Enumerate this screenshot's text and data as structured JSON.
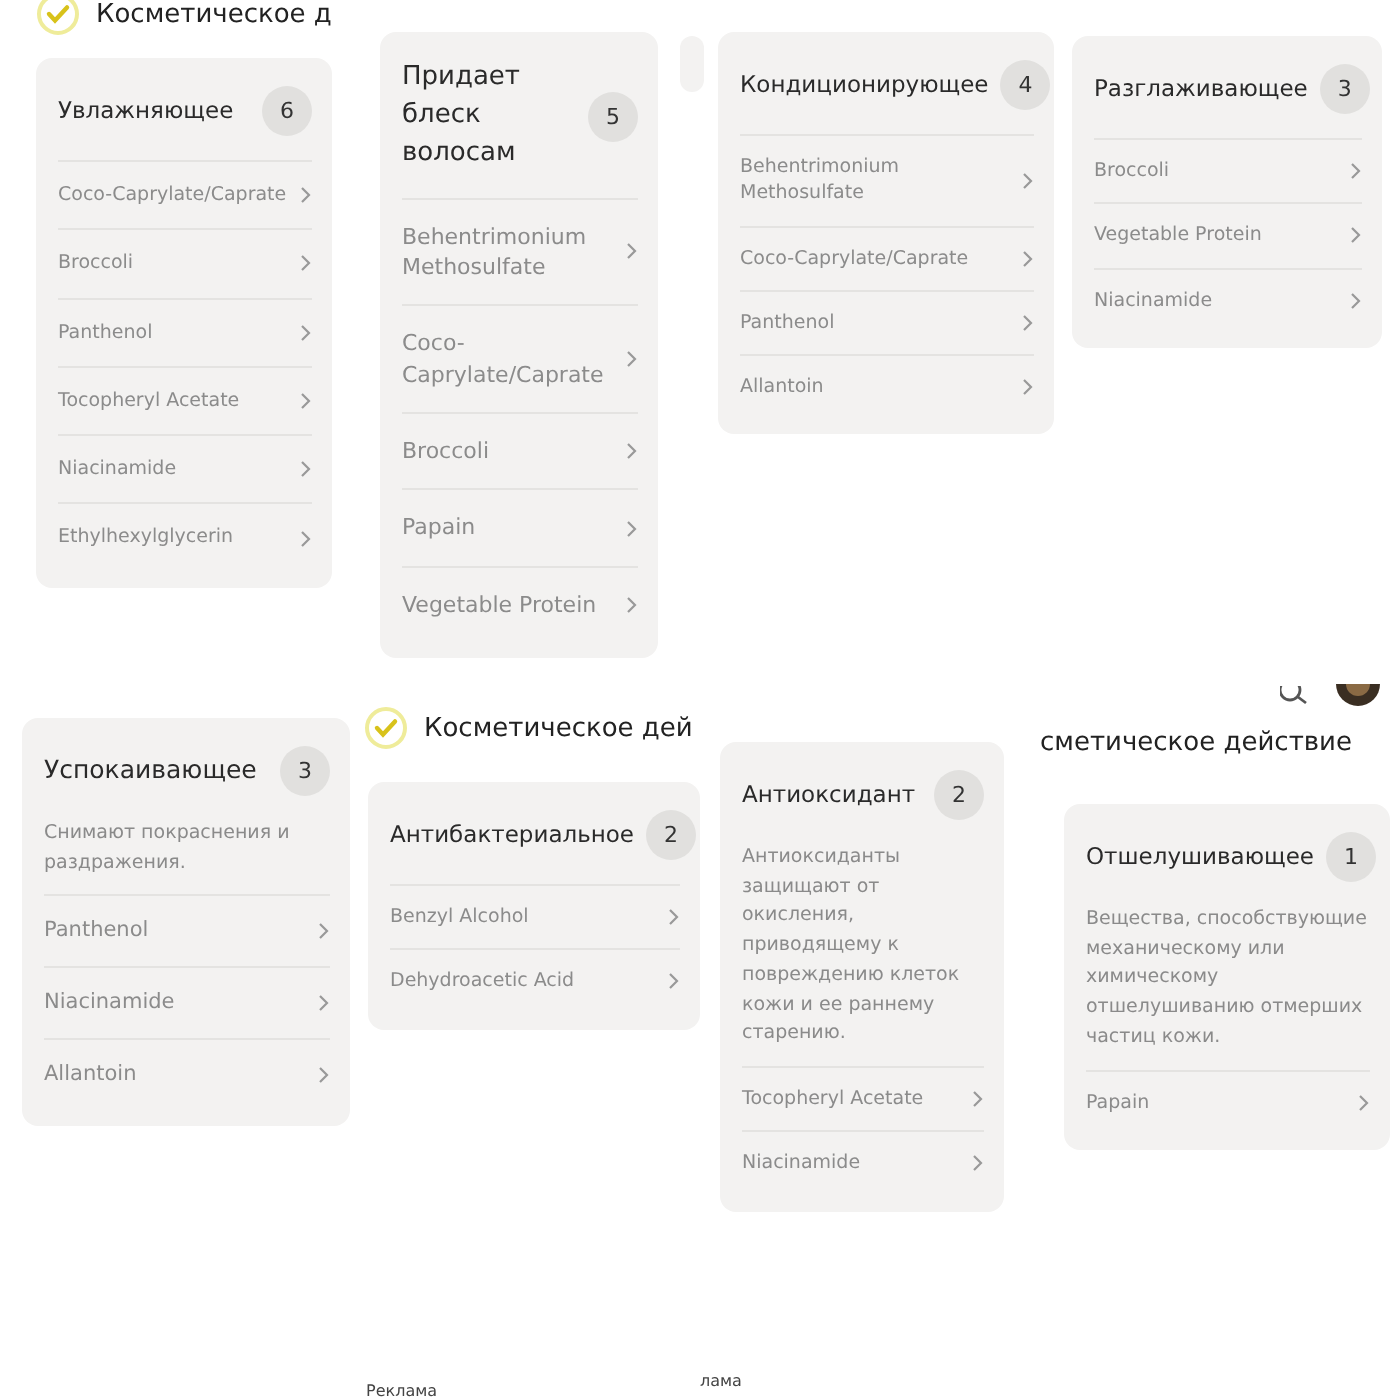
{
  "pieces": [
    {
      "kind": "heading",
      "text": "Косметическое д",
      "check": true
    },
    {
      "kind": "card",
      "title": "Увлажняющее",
      "count": "6",
      "items": [
        "Coco-Caprylate/Caprate",
        "Broccoli",
        "Panthenol",
        "Tocopheryl Acetate",
        "Niacinamide",
        "Ethylhexylglycerin"
      ]
    },
    {
      "kind": "card",
      "title": "Придает блеск волосам",
      "count": "5",
      "items": [
        "Behentrimonium Methosulfate",
        "Coco-Caprylate/Caprate",
        "Broccoli",
        "Papain",
        "Vegetable Protein"
      ]
    },
    {
      "kind": "card",
      "title": "Кондиционирующее",
      "count": "4",
      "items": [
        "Behentrimonium Methosulfate",
        "Coco-Caprylate/Caprate",
        "Panthenol",
        "Allantoin"
      ]
    },
    {
      "kind": "card",
      "title": "Разглаживающее",
      "count": "3",
      "items": [
        "Broccoli",
        "Vegetable Protein",
        "Niacinamide"
      ]
    },
    {
      "kind": "card",
      "title": "Успокаивающее",
      "count": "3",
      "description": "Снимают покраснения и раздражения.",
      "items": [
        "Panthenol",
        "Niacinamide",
        "Allantoin"
      ]
    },
    {
      "kind": "heading",
      "text": "Косметическое дей",
      "check": true
    },
    {
      "kind": "card",
      "title": "Антибактериальное",
      "count": "2",
      "items": [
        "Benzyl Alcohol",
        "Dehydroacetic Acid"
      ]
    },
    {
      "kind": "card",
      "title": "Антиоксидант",
      "count": "2",
      "description": "Антиоксиданты защищают от окисления, приводящему к повреждению клеток кожи и ее раннему старению.",
      "items": [
        "Tocopheryl Acetate",
        "Niacinamide"
      ]
    },
    {
      "kind": "heading",
      "text": "сметическое действие",
      "check": false
    },
    {
      "kind": "card",
      "title": "Отшелушивающее",
      "count": "1",
      "description": "Вещества, способствующие механическому или химическому отшелушиванию отмерших частиц кожи.",
      "items": [
        "Papain"
      ]
    },
    {
      "kind": "toolbar"
    },
    {
      "kind": "caption",
      "text": "Реклама"
    },
    {
      "kind": "caption",
      "text": "лама"
    }
  ]
}
